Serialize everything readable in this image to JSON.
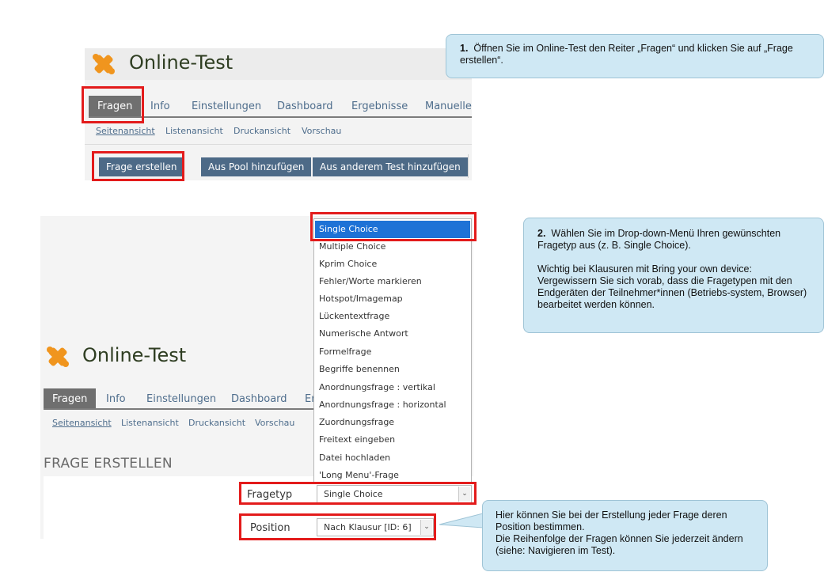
{
  "app": {
    "title": "Online-Test",
    "tabs": [
      "Fragen",
      "Info",
      "Einstellungen",
      "Dashboard",
      "Ergebnisse",
      "Manuelle"
    ],
    "tabs_bottom": [
      "Fragen",
      "Info",
      "Einstellungen",
      "Dashboard",
      "Er"
    ],
    "subtabs": [
      "Seitenansicht",
      "Listenansicht",
      "Druckansicht",
      "Vorschau"
    ],
    "buttons": {
      "create": "Frage erstellen",
      "pool": "Aus Pool hinzufügen",
      "other_test": "Aus anderem Test hinzufügen"
    }
  },
  "form": {
    "heading": "FRAGE ERSTELLEN",
    "fragetyp_label": "Fragetyp",
    "fragetyp_value": "Single Choice",
    "position_label": "Position",
    "position_value": "Nach Klausur [ID: 6]"
  },
  "dropdown": {
    "items": [
      "Single Choice",
      "Multiple Choice",
      "Kprim Choice",
      "Fehler/Worte markieren",
      "Hotspot/Imagemap",
      "Lückentextfrage",
      "Numerische Antwort",
      "Formelfrage",
      "Begriffe benennen",
      "Anordnungsfrage : vertikal",
      "Anordnungsfrage : horizontal",
      "Zuordnungsfrage",
      "Freitext eingeben",
      "Datei hochladen",
      "'Long Menu'-Frage"
    ],
    "selected": "Single Choice"
  },
  "callouts": {
    "c1": {
      "number": "1.",
      "text": "Öffnen Sie im Online-Test den Reiter „Fragen“ und klicken Sie auf „Frage erstellen“."
    },
    "c2": {
      "number": "2.",
      "line1": "Wählen Sie im Drop-down-Menü Ihren gewünschten Fragetyp aus (z. B. Single Choice).",
      "line2": "Wichtig bei Klausuren mit Bring your own device: Vergewissern Sie sich vorab, dass die Fragetypen mit den Endgeräten der Teilnehmer*innen (Betriebs-system, Browser) bearbeitet werden können."
    },
    "c3": {
      "line1": "Hier können Sie bei der Erstellung jeder Frage deren Position bestimmen.",
      "line2": "Die Reihenfolge der Fragen können Sie jederzeit ändern (siehe: Navigieren im Test)."
    }
  },
  "colors": {
    "highlight_red": "#e31b1b",
    "button_blue": "#4d6a87",
    "dropdown_selected": "#1e72d6",
    "callout_bg": "#cfe8f4",
    "logo_orange": "#f0951e"
  },
  "icons": {
    "logo": "puzzle-icon",
    "select_arrow": "chevron-down-icon"
  }
}
